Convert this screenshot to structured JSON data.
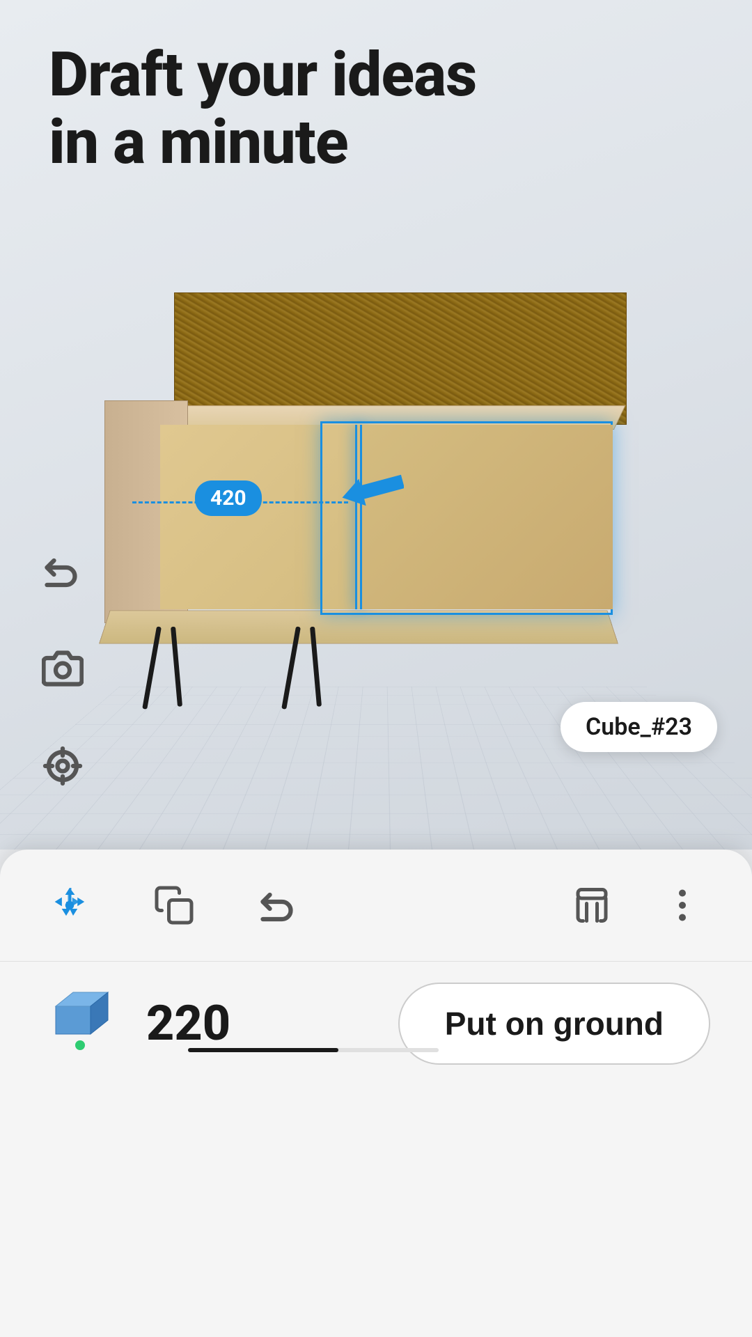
{
  "title": "Draft your ideas\nin a minute",
  "canvas": {
    "object_name": "Cube_#23",
    "measurement_value": "420",
    "selected": true
  },
  "toolbar_left": {
    "undo_label": "Undo",
    "camera_label": "Camera",
    "focus_label": "Focus"
  },
  "bottom_panel": {
    "move_button_label": "Move",
    "duplicate_button_label": "Duplicate",
    "undo_button_label": "Undo",
    "paint_button_label": "Paint",
    "more_button_label": "More",
    "height_value": "220",
    "put_on_ground_label": "Put on ground"
  }
}
